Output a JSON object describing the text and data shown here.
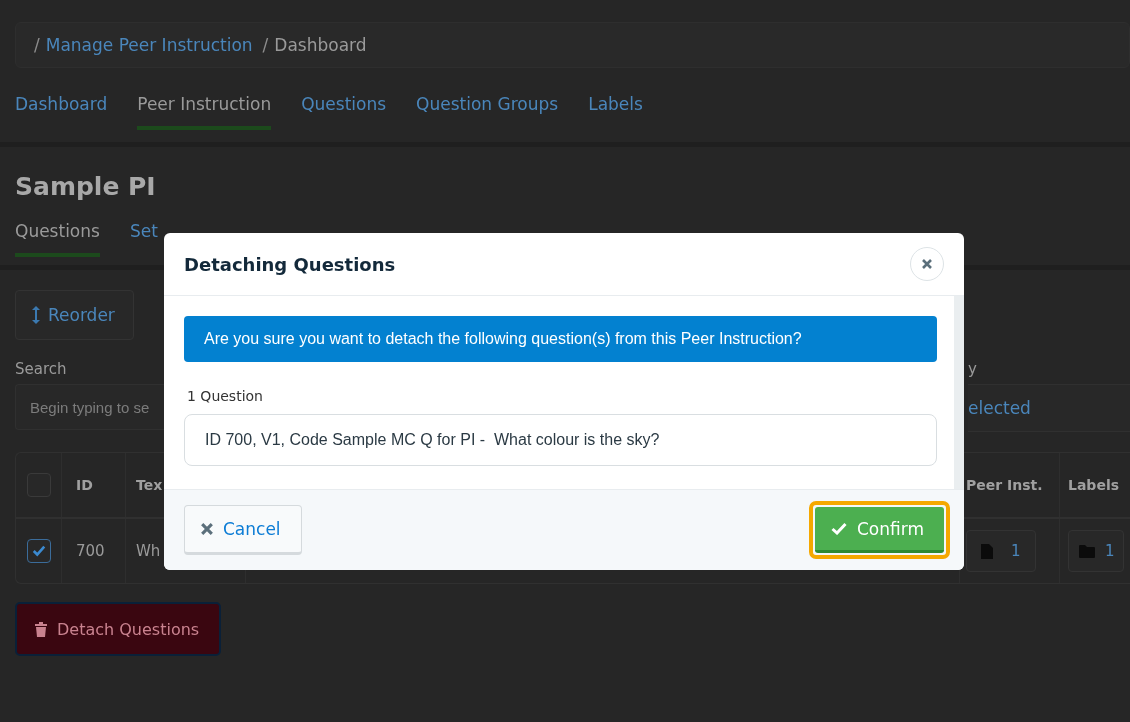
{
  "breadcrumb": {
    "separator_1": "/",
    "link": "Manage Peer Instruction",
    "separator_2": "/",
    "current": "Dashboard"
  },
  "tabs": [
    {
      "label": "Dashboard",
      "selected": false
    },
    {
      "label": "Peer Instruction",
      "selected": true
    },
    {
      "label": "Questions",
      "selected": false
    },
    {
      "label": "Question Groups",
      "selected": false
    },
    {
      "label": "Labels",
      "selected": false
    }
  ],
  "title": "Sample PI",
  "subtabs": [
    {
      "label": "Questions",
      "selected": true
    },
    {
      "label": "Set",
      "selected": false
    }
  ],
  "reorder_button": "Reorder",
  "search": {
    "label": "Search",
    "placeholder": "Begin typing to se"
  },
  "filter": {
    "label": "y",
    "value": "elected"
  },
  "table": {
    "header_checked": false,
    "columns": [
      "ID",
      "Tex",
      "Peer Inst.",
      "Labels"
    ],
    "rows": [
      {
        "checked": true,
        "id": "700",
        "text": "Wh",
        "peer_inst": "1",
        "labels": "1"
      }
    ]
  },
  "detach_button": "Detach Questions",
  "modal": {
    "title": "Detaching Questions",
    "alert": "Are you sure you want to detach the following question(s) from this Peer Instruction?",
    "count": "1 Question",
    "items": [
      "ID 700, V1, Code Sample MC Q for PI -  What colour is the sky?"
    ],
    "cancel": "Cancel",
    "confirm": "Confirm"
  }
}
